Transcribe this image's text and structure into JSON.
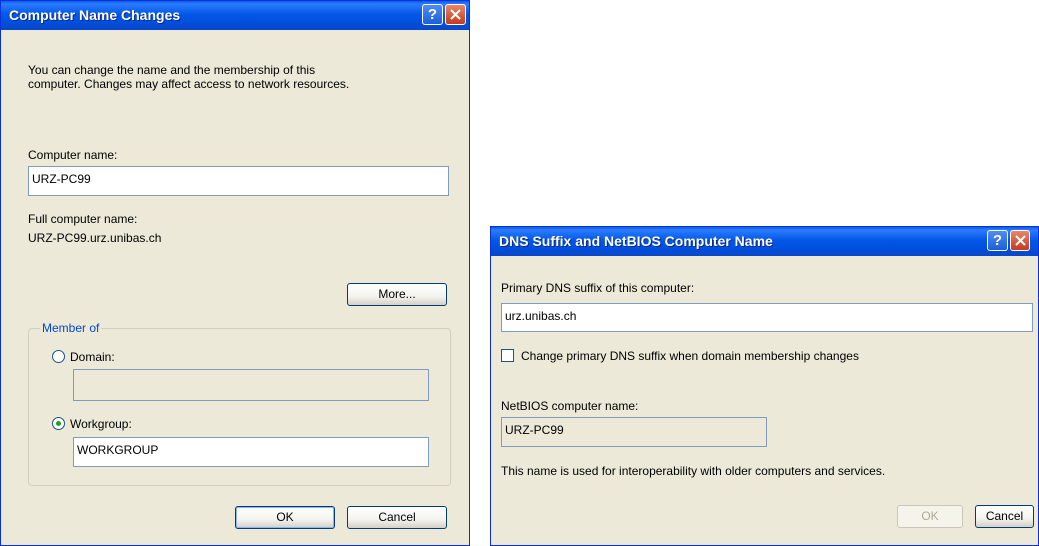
{
  "dialog1": {
    "title": "Computer Name Changes",
    "help_glyph": "?",
    "description_line1": "You can change the name and the membership of this",
    "description_line2": "computer. Changes may affect access to network resources.",
    "computer_name_label": "Computer name:",
    "computer_name_value": "URZ-PC99",
    "full_name_label": "Full computer name:",
    "full_name_value": "URZ-PC99.urz.unibas.ch",
    "more_button": "More...",
    "member_of_label": "Member of",
    "domain_label": "Domain:",
    "domain_value": "",
    "workgroup_label": "Workgroup:",
    "workgroup_value": "WORKGROUP",
    "selected_membership": "workgroup",
    "ok_button": "OK",
    "cancel_button": "Cancel"
  },
  "dialog2": {
    "title": "DNS Suffix and NetBIOS Computer Name",
    "help_glyph": "?",
    "dns_suffix_label": "Primary DNS suffix of this computer:",
    "dns_suffix_value": "urz.unibas.ch",
    "change_suffix_label": "Change primary DNS suffix when domain membership changes",
    "change_suffix_checked": false,
    "netbios_label": "NetBIOS computer name:",
    "netbios_value": "URZ-PC99",
    "info_text": "This name is used for interoperability with older computers and services.",
    "ok_button": "OK",
    "cancel_button": "Cancel"
  },
  "colors": {
    "titlebar": "#0054e3",
    "dialog_bg": "#ece9d8",
    "group_label": "#0046d5",
    "radio_dot": "#21a121"
  },
  "icons": [
    "help-icon",
    "close-icon"
  ]
}
